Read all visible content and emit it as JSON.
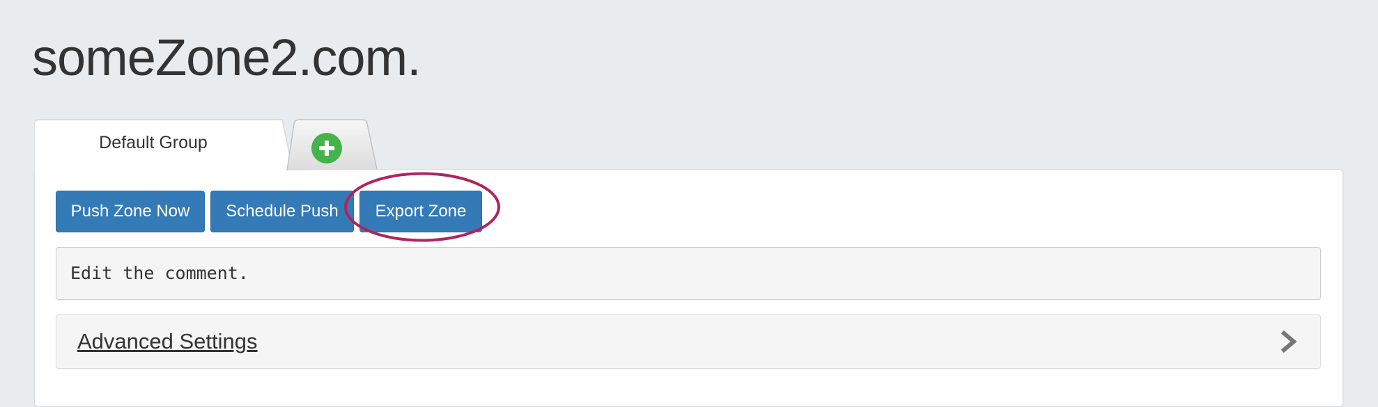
{
  "page": {
    "title": "someZone2.com."
  },
  "tabs": [
    {
      "label": "Default Group",
      "active": true
    }
  ],
  "add_tab_icon": "plus-circle-icon",
  "toolbar": {
    "push_label": "Push Zone Now",
    "schedule_label": "Schedule Push",
    "export_label": "Export Zone"
  },
  "comment": {
    "value": "Edit the comment."
  },
  "advanced": {
    "label": "Advanced Settings",
    "icon": "chevron-right-icon"
  },
  "colors": {
    "primary_button": "#337ab7",
    "add_icon": "#43b34a",
    "highlight": "#b0245e",
    "background": "#e9ecef"
  }
}
